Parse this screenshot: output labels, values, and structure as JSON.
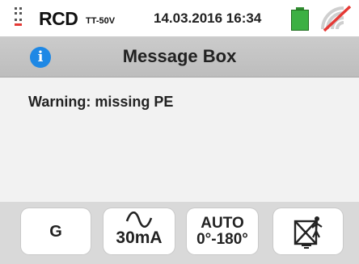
{
  "status_bar": {
    "title": "RCD",
    "subtitle": "TT-50V",
    "datetime": "14.03.2016  16:34",
    "battery_color": "#3cb043",
    "signal_icon": "wireless-disabled-icon"
  },
  "header": {
    "icon": "info-icon",
    "icon_glyph": "i",
    "title": "Message Box"
  },
  "message": {
    "text": "Warning: missing PE"
  },
  "softkeys": {
    "key1": {
      "label": "G"
    },
    "key2": {
      "icon": "ac-wave-icon",
      "label": "30mA"
    },
    "key3": {
      "line1": "AUTO",
      "line2": "0°-180°"
    },
    "key4": {
      "icon": "no-touch-earth-icon"
    }
  },
  "colors": {
    "header_bg": "#c4c4c4",
    "softkey_bar_bg": "#d9d9d9",
    "info_blue": "#1e88e5",
    "signal_red": "#e53935"
  }
}
